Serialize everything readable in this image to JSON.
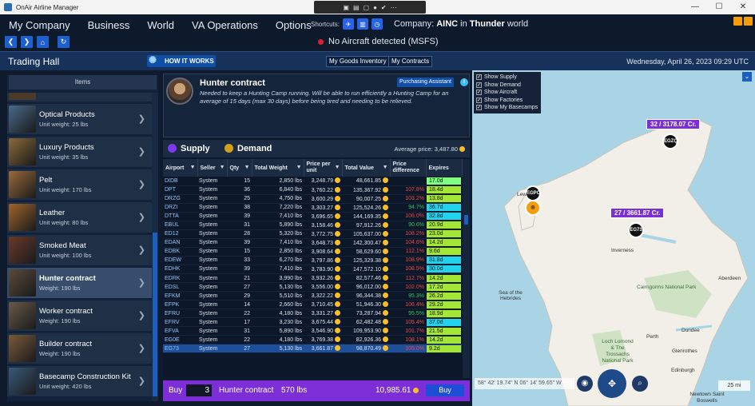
{
  "window": {
    "title": "OnAir Airline Manager"
  },
  "menu": [
    "My Company",
    "Business",
    "World",
    "VA Operations",
    "Options"
  ],
  "shortcuts_label": "Shortcuts:",
  "company": {
    "prefix": "Company:",
    "name": "AINC",
    "in": "in",
    "world": "Thunder",
    "suffix": "world"
  },
  "status": "No Aircraft detected (MSFS)",
  "section_title": "Trading Hall",
  "how_it_works": "HOW IT WORKS",
  "tabs": [
    "My Goods Inventory",
    "My Contracts"
  ],
  "date": "Wednesday, April 26, 2023 09:29 UTC",
  "items_header": "Items",
  "items": [
    {
      "name": "Optical Products",
      "weight": "Unit weight: 25 lbs",
      "color": "#4a6a8a"
    },
    {
      "name": "Luxury Products",
      "weight": "Unit weight: 35 lbs",
      "color": "#8a6a3a"
    },
    {
      "name": "Pelt",
      "weight": "Unit weight: 170 lbs",
      "color": "#9a6a3a"
    },
    {
      "name": "Leather",
      "weight": "Unit weight: 80 lbs",
      "color": "#a0642a"
    },
    {
      "name": "Smoked Meat",
      "weight": "Unit weight: 100 lbs",
      "color": "#6a3a2a"
    },
    {
      "name": "Hunter contract",
      "weight": "Weight: 190 lbs",
      "color": "#5b4a3a"
    },
    {
      "name": "Worker contract",
      "weight": "Weight: 190 lbs",
      "color": "#6a5a4a"
    },
    {
      "name": "Builder contract",
      "weight": "Weight: 190 lbs",
      "color": "#7a5a3a"
    },
    {
      "name": "Basecamp Construction Kit",
      "weight": "Unit weight: 420 lbs",
      "color": "#3a5a7a"
    }
  ],
  "contract": {
    "title": "Hunter contract",
    "assistant": "Purchasing Assistant",
    "description": "Needed to keep a Hunting Camp running. Will be able to run efficiently a Hunting Camp for an average of 15 days (max 30 days) before being tired and needing to be relieved."
  },
  "market": {
    "supply_label": "Supply",
    "demand_label": "Demand",
    "avg_label": "Average price:",
    "avg_value": "3,487.80",
    "columns": [
      "Airport",
      "Seller",
      "Qty",
      "Total Weight",
      "Price per unit",
      "Total Value",
      "Price difference",
      "Expires"
    ],
    "rows": [
      [
        "DIDB",
        "System",
        "15",
        "2,850 lbs",
        "3,248.79",
        "48,661.85",
        "",
        "17.0d",
        "#7fff7f"
      ],
      [
        "DPT",
        "System",
        "36",
        "6,840 lbs",
        "3,760.22",
        "135,367.92",
        "107.8%",
        "18.4d",
        "#a3e635"
      ],
      [
        "DRZG",
        "System",
        "25",
        "4,750 lbs",
        "3,600.29",
        "90,007.25",
        "103.2%",
        "13.8d",
        "#a3e635"
      ],
      [
        "DRZI",
        "System",
        "38",
        "7,220 lbs",
        "3,303.27",
        "125,524.26",
        "94.7%",
        "36.7d",
        "#22d3ee"
      ],
      [
        "DTTA",
        "System",
        "39",
        "7,410 lbs",
        "3,696.65",
        "144,169.35",
        "106.0%",
        "32.8d",
        "#22d3ee"
      ],
      [
        "EBUL",
        "System",
        "31",
        "5,890 lbs",
        "3,158.46",
        "97,912.26",
        "90.6%",
        "20.9d",
        "#a3e635"
      ],
      [
        "ED12",
        "System",
        "28",
        "5,320 lbs",
        "3,772.75",
        "105,637.00",
        "108.2%",
        "23.0d",
        "#a3e635"
      ],
      [
        "EDAN",
        "System",
        "39",
        "7,410 lbs",
        "3,648.73",
        "142,300.47",
        "104.6%",
        "14.2d",
        "#a3e635"
      ],
      [
        "EDBK",
        "System",
        "15",
        "2,850 lbs",
        "3,908.64",
        "58,629.60",
        "112.1%",
        "9.6d",
        "#a3e635"
      ],
      [
        "EDEW",
        "System",
        "33",
        "6,270 lbs",
        "3,797.86",
        "125,329.38",
        "108.9%",
        "31.8d",
        "#22d3ee"
      ],
      [
        "EDHK",
        "System",
        "39",
        "7,410 lbs",
        "3,783.90",
        "147,572.10",
        "108.5%",
        "30.0d",
        "#22d3ee"
      ],
      [
        "EDRK",
        "System",
        "21",
        "3,990 lbs",
        "3,932.26",
        "82,577.46",
        "112.7%",
        "14.2d",
        "#a3e635"
      ],
      [
        "EDSL",
        "System",
        "27",
        "5,130 lbs",
        "3,556.00",
        "96,012.00",
        "102.0%",
        "17.2d",
        "#a3e635"
      ],
      [
        "EFKM",
        "System",
        "29",
        "5,510 lbs",
        "3,322.22",
        "96,344.38",
        "95.3%",
        "26.2d",
        "#a3e635"
      ],
      [
        "EFPK",
        "System",
        "14",
        "2,660 lbs",
        "3,710.45",
        "51,946.30",
        "106.4%",
        "29.2d",
        "#a3e635"
      ],
      [
        "EFRU",
        "System",
        "22",
        "4,180 lbs",
        "3,331.27",
        "73,287.94",
        "95.5%",
        "18.9d",
        "#a3e635"
      ],
      [
        "EFRV",
        "System",
        "17",
        "3,230 lbs",
        "3,675.44",
        "62,482.48",
        "105.4%",
        "37.0d",
        "#22d3ee"
      ],
      [
        "EFVA",
        "System",
        "31",
        "5,890 lbs",
        "3,546.90",
        "109,953.90",
        "101.7%",
        "21.5d",
        "#a3e635"
      ],
      [
        "EG0E",
        "System",
        "22",
        "4,180 lbs",
        "3,769.38",
        "82,926.36",
        "108.1%",
        "14.2d",
        "#a3e635"
      ],
      [
        "EG73",
        "System",
        "27",
        "5,130 lbs",
        "3,661.87",
        "98,870.49",
        "105.0%",
        "9.2d",
        "#a3e635"
      ]
    ]
  },
  "buy": {
    "label": "Buy",
    "qty": "3",
    "item": "Hunter contract",
    "weight": "570 lbs",
    "total": "10,985.61",
    "button": "Buy"
  },
  "map": {
    "layers": [
      "Show Supply",
      "Show Demand",
      "Show Aircraft",
      "Show Factories",
      "Show My Basecamps"
    ],
    "labels": [
      {
        "text": "32 / 3178.07 Cr.",
        "marker": "EGZQ"
      },
      {
        "text": "27 / 3661.87 Cr.",
        "marker": "EG73"
      }
    ],
    "markers": [
      "EGPO"
    ],
    "places": [
      "Inverness",
      "Aberdeen",
      "Sea of the Hebrides",
      "Cairngorms National Park",
      "Perth",
      "Dundee",
      "Glenrothes",
      "Edinburgh",
      "Loch Lomond & The Trossachs National Park",
      "Newtown Saint Boswells",
      "Lewis"
    ],
    "coords": "58° 42' 19.74\" N 06° 14' 59.65\" W",
    "scale": "25 mi"
  }
}
